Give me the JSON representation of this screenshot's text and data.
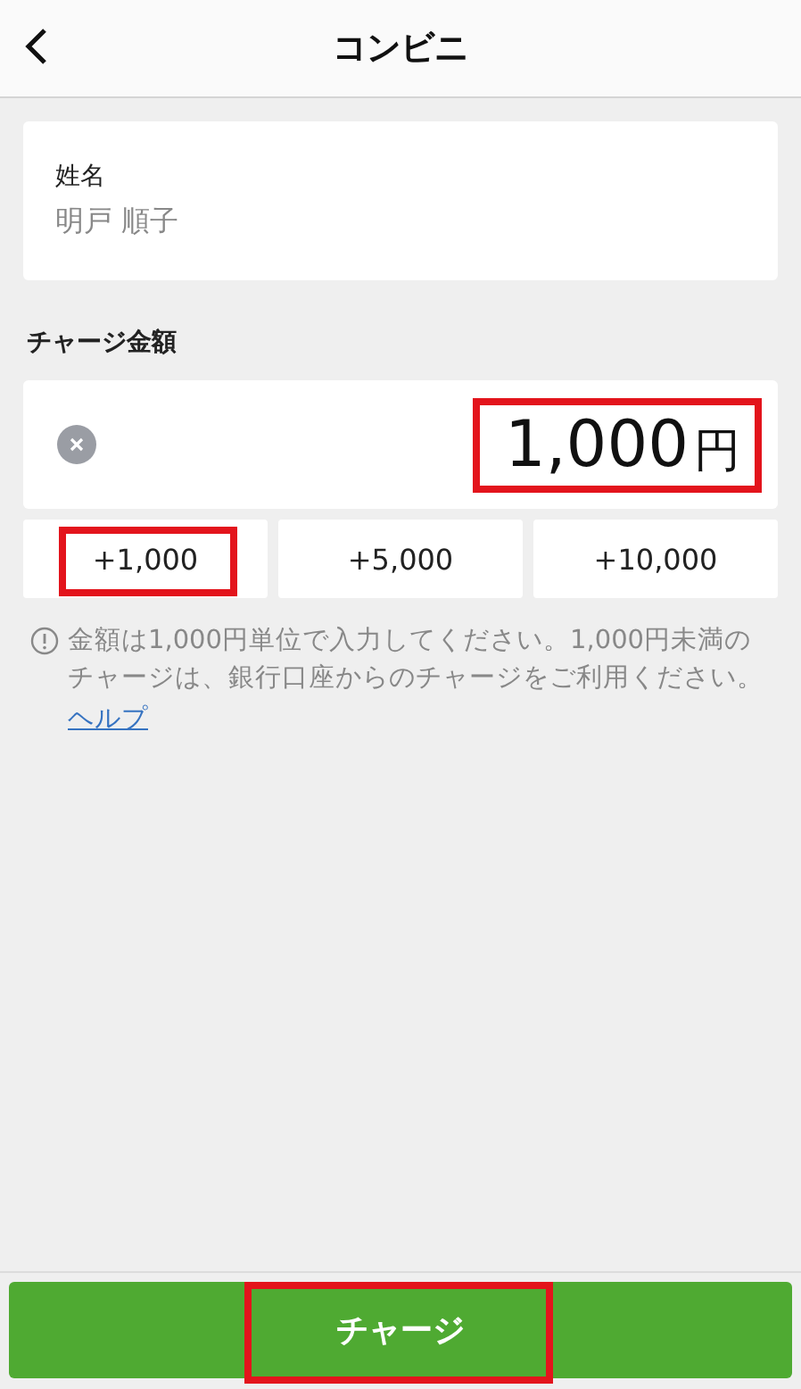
{
  "header": {
    "title": "コンビニ"
  },
  "name_card": {
    "label": "姓名",
    "value": "明戸 順子"
  },
  "amount_section": {
    "label": "チャージ金額",
    "amount": "1,000",
    "currency": "円",
    "highlighted": true
  },
  "quick_amounts": [
    {
      "label": "+1,000",
      "highlighted": true
    },
    {
      "label": "+5,000",
      "highlighted": false
    },
    {
      "label": "+10,000",
      "highlighted": false
    }
  ],
  "notice": {
    "text": "金額は1,000円単位で入力してください。1,000円未満のチャージは、銀行口座からのチャージをご利用ください。",
    "link": "ヘルプ"
  },
  "charge_button": {
    "label": "チャージ",
    "highlighted": true
  }
}
